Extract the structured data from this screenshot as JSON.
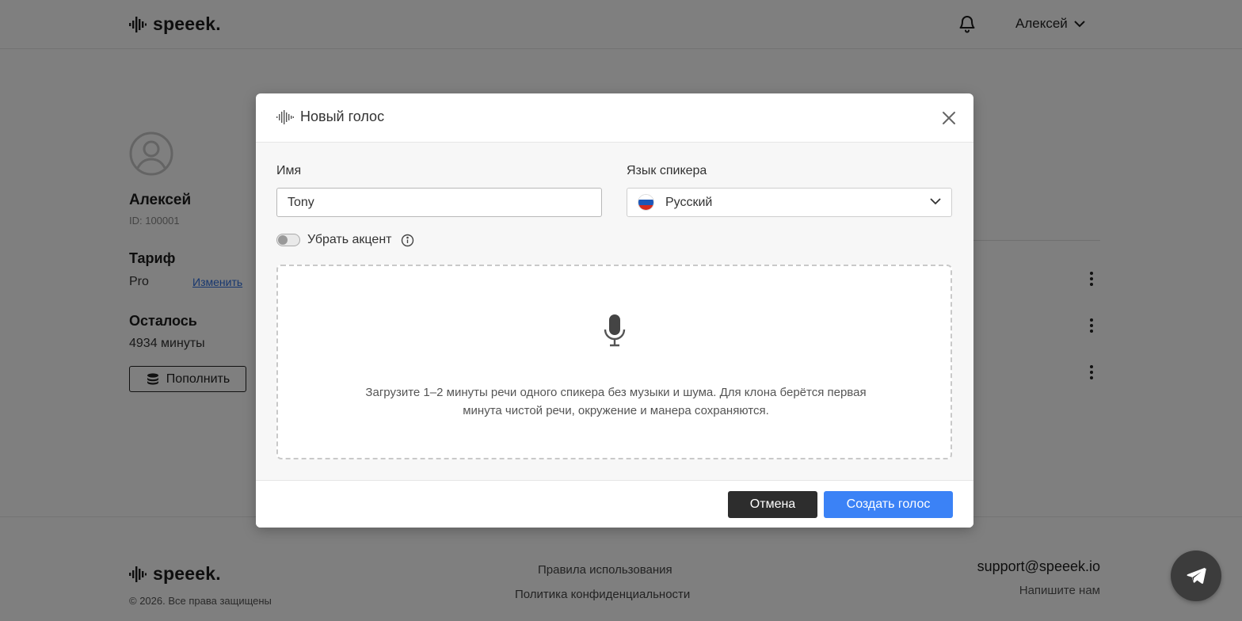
{
  "header": {
    "logo_text": "speeek.",
    "user_name": "Алексей"
  },
  "profile": {
    "name": "Алексей",
    "id_text": "ID: 100001",
    "plan_title": "Тариф",
    "plan_value": "Pro",
    "change_label": "Изменить",
    "remaining_title": "Осталось",
    "remaining_value": "4934 минуты",
    "topup_label": "Пополнить"
  },
  "footer": {
    "logo_text": "speeek.",
    "copyright": "© 2026. Все права защищены",
    "terms_link": "Правила использования",
    "privacy_link": "Политика конфиденциальности",
    "support_email": "support@speeek.io",
    "write_us": "Напишите нам"
  },
  "modal": {
    "title": "Новый голос",
    "name_label": "Имя",
    "name_value": "Tony",
    "language_label": "Язык спикера",
    "language_value": "Русский",
    "remove_accent_label": "Убрать акцент",
    "remove_accent_on": false,
    "dropzone_text": "Загрузите 1–2 минуты речи одного спикера без музыки и шума. Для клона берётся первая минута чистой речи, окружение и манера сохраняются.",
    "cancel_label": "Отмена",
    "create_label": "Создать голос"
  },
  "colors": {
    "primary": "#3b82f6",
    "dark": "#2d2d2d",
    "link": "#2f6fde"
  }
}
